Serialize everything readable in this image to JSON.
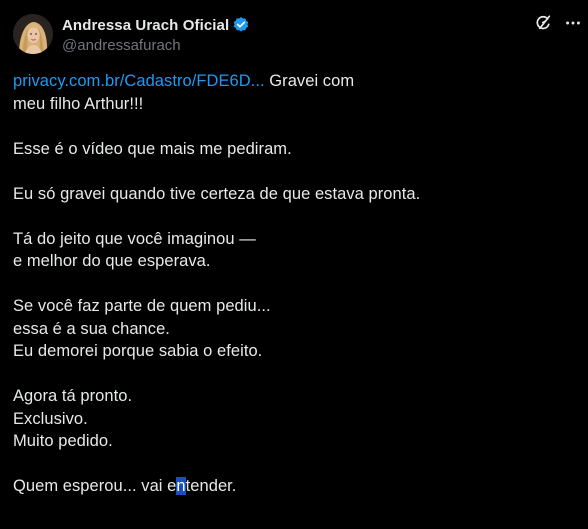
{
  "author": {
    "display_name": "Andressa Urach Oficial",
    "handle": "@andressafurach",
    "verified": true,
    "avatar_icon": "profile-photo"
  },
  "actions": {
    "grok_icon": "grok-icon",
    "more_icon": "more-options-icon"
  },
  "post": {
    "link_text": "privacy.com.br/Cadastro/FDE6D...",
    "line1_rest": " Gravei com",
    "line2": "meu filho Arthur!!!",
    "line3": "Esse é o vídeo que mais me pediram.",
    "line4": "Eu só gravei quando tive certeza de que estava pronta.",
    "line5": "Tá do jeito que você imaginou —",
    "line6": "e melhor do que esperava.",
    "line7": "Se você faz parte de quem pediu...",
    "line8": "essa é a sua chance.",
    "line9": "Eu demorei porque sabia o efeito.",
    "line10": "Agora tá pronto.",
    "line11": "Exclusivo.",
    "line12": "Muito pedido.",
    "line13_before": "Quem esperou... vai e",
    "line13_selected": "n",
    "line13_after": "tender."
  },
  "colors": {
    "background": "#000000",
    "text": "#e7e9ea",
    "secondary": "#71767b",
    "link": "#1d9bf0",
    "verified_badge": "#1d9bf0",
    "selection": "#1a4fbf"
  }
}
